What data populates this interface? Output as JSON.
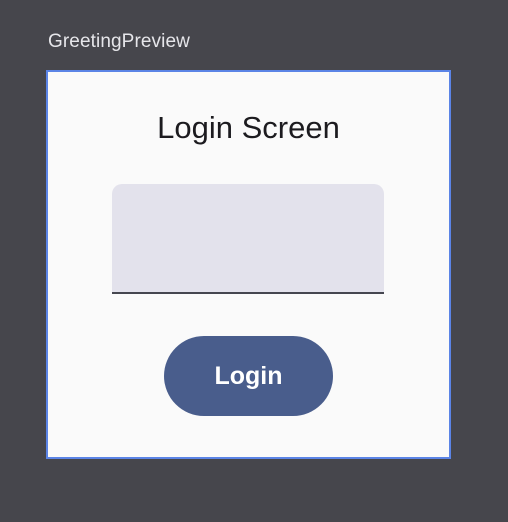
{
  "preview": {
    "label": "GreetingPreview"
  },
  "screen": {
    "title": "Login Screen",
    "text_field": {
      "value": "",
      "placeholder": ""
    },
    "login_button_label": "Login"
  },
  "colors": {
    "background": "#46464c",
    "frame_border": "#5b84e6",
    "surface": "#fafafa",
    "field_fill": "#e3e2ec",
    "field_indicator": "#45464f",
    "primary": "#495d8c",
    "on_primary": "#ffffff"
  }
}
